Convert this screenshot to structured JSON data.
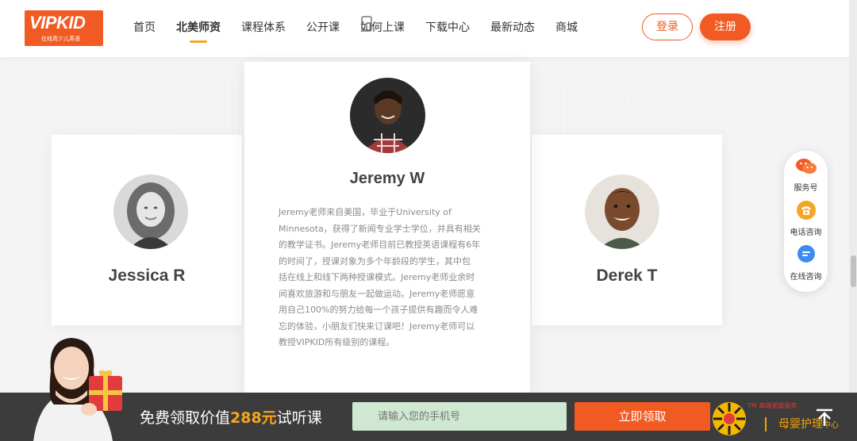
{
  "header": {
    "logo_text": "VIPKID",
    "logo_sub": "在线青少儿英语",
    "nav": [
      "首页",
      "北美师资",
      "课程体系",
      "公开课",
      "如何上课",
      "下载中心",
      "最新动态",
      "商城"
    ],
    "active_nav": "北美师资",
    "login_label": "登录",
    "register_label": "注册"
  },
  "teachers": {
    "left": {
      "name": "Jessica R"
    },
    "center": {
      "name": "Jeremy W",
      "bio_lines": [
        "Jeremy老师来自美国，毕业于University of",
        "Minnesota，获得了新闻专业学士学位，并具有相关",
        "的教学证书。Jeremy老师目前已教授英语课程有6年",
        "的时间了，授课对象为多个年龄段的学生，其中包",
        "括在线上和线下两种授课模式。Jeremy老师业余时",
        "间喜欢旅游和与朋友一起做运动。Jeremy老师愿意",
        "用自己100%的努力给每一个孩子提供有趣而令人难",
        "忘的体验，小朋友们快来订课吧！Jeremy老师可以",
        "教授VIPKID所有级别的课程。"
      ]
    },
    "right": {
      "name": "Derek T"
    }
  },
  "side_panel": {
    "items": [
      {
        "label": "服务号",
        "icon": "wechat-icon"
      },
      {
        "label": "电话咨询",
        "icon": "phone-icon"
      },
      {
        "label": "在线咨询",
        "icon": "chat-icon"
      }
    ]
  },
  "promo": {
    "text_before": "免费领取价值",
    "price": "288元",
    "text_after": "试听课",
    "phone_placeholder": "请输入您的手机号",
    "claim_label": "立即领取"
  },
  "watermark": {
    "tm_text": "TM 高端家庭服务",
    "main": "母婴护理",
    "suffix": "中心"
  },
  "colors": {
    "brand": "#f15a22",
    "accent": "#f5a623",
    "promo_bg": "#3c3c3c",
    "price": "#f7a51c"
  }
}
